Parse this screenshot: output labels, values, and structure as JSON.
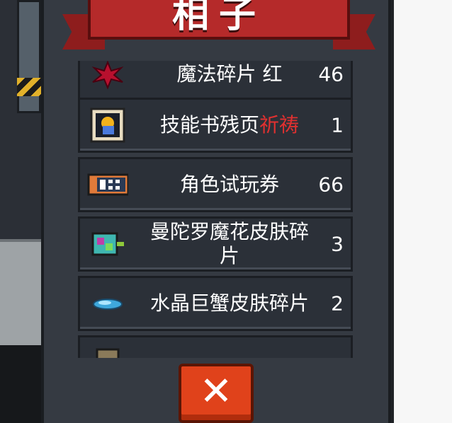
{
  "banner": {
    "title": "相子"
  },
  "items": [
    {
      "name": "魔法碎片 红",
      "highlight": "",
      "count": "46",
      "icon": "magic-fragment-red-icon"
    },
    {
      "name": "技能书残页",
      "highlight": "祈祷",
      "count": "1",
      "icon": "skill-book-page-icon"
    },
    {
      "name": "角色试玩券",
      "highlight": "",
      "count": "66",
      "icon": "trial-ticket-icon"
    },
    {
      "name": "曼陀罗魔花皮肤碎片",
      "highlight": "",
      "count": "3",
      "icon": "mandala-flower-skin-icon"
    },
    {
      "name": "水晶巨蟹皮肤碎片",
      "highlight": "",
      "count": "2",
      "icon": "crystal-crab-skin-icon"
    }
  ],
  "close": {
    "icon": "close-icon",
    "label": "✕"
  },
  "colors": {
    "banner": "#b52a2a",
    "highlight": "#e03030",
    "close_button": "#e0421b"
  }
}
